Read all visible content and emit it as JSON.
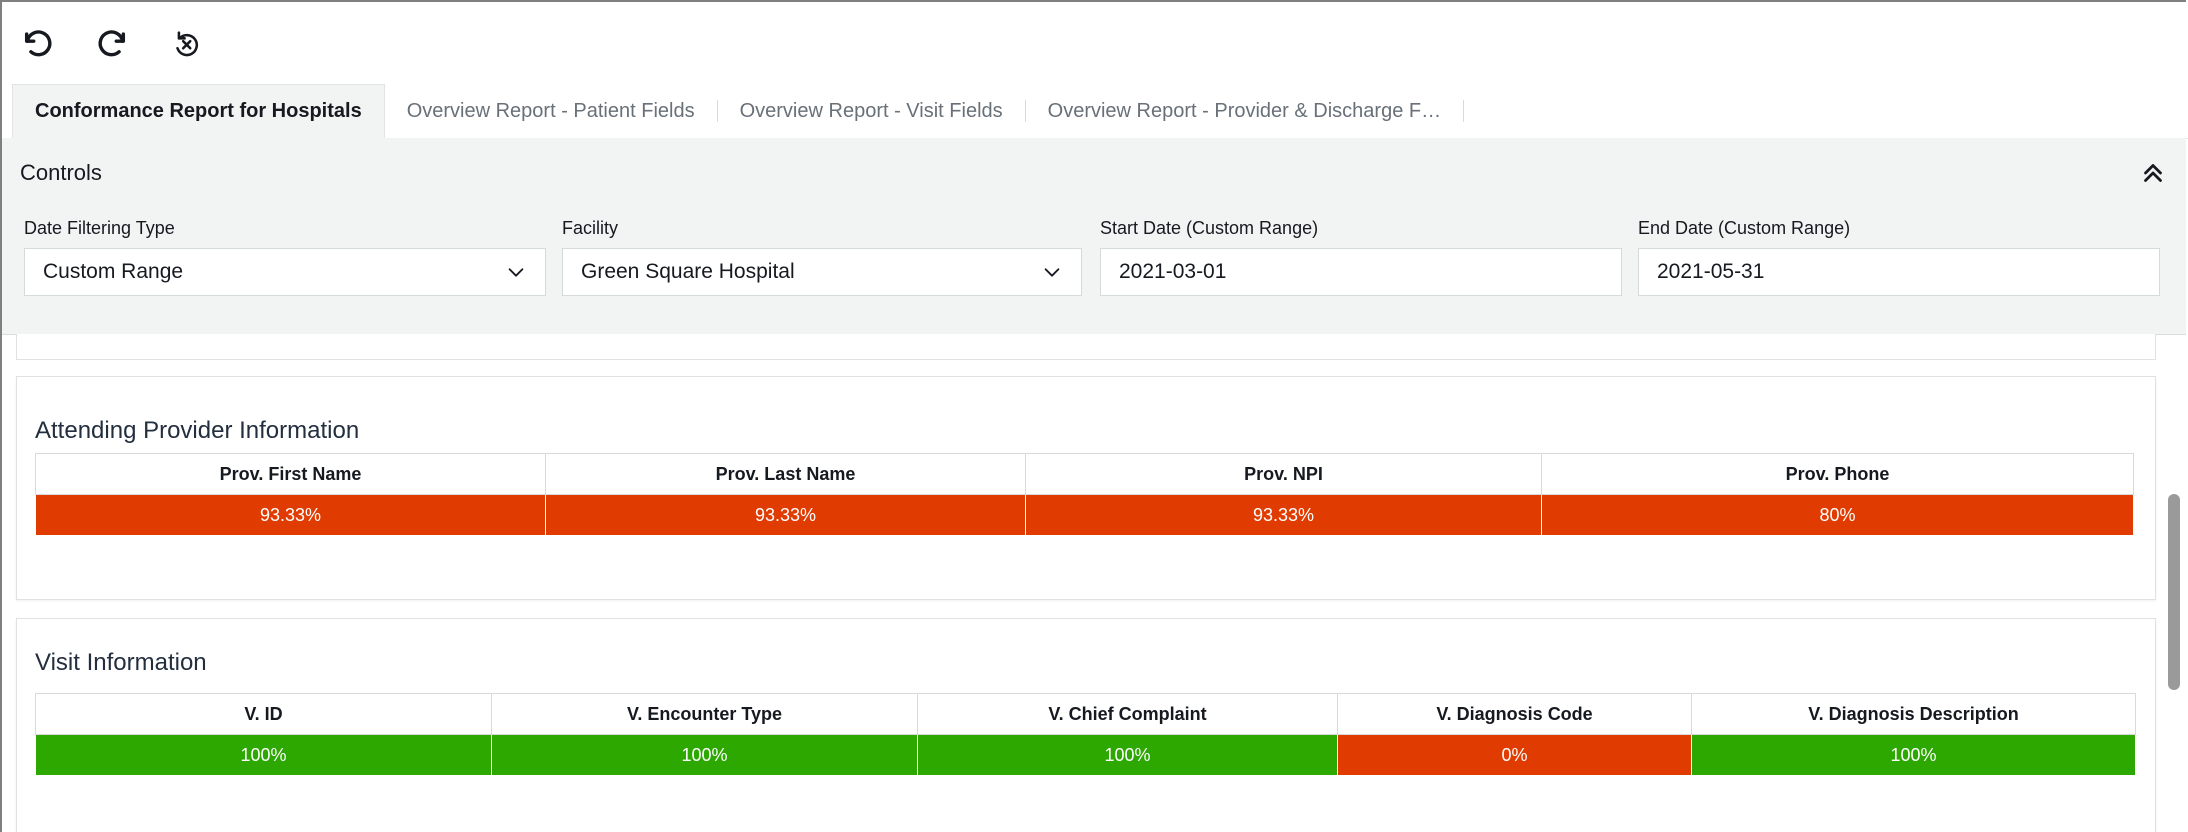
{
  "toolbar": {
    "undo_icon": "undo-icon",
    "redo_icon": "redo-icon",
    "reset_icon": "reset-icon"
  },
  "tabs": [
    {
      "label": "Conformance Report for Hospitals",
      "active": true
    },
    {
      "label": "Overview Report - Patient Fields",
      "active": false
    },
    {
      "label": "Overview Report - Visit Fields",
      "active": false
    },
    {
      "label": "Overview Report - Provider & Discharge F…",
      "active": false
    }
  ],
  "controls": {
    "title": "Controls",
    "date_filtering_type": {
      "label": "Date Filtering Type",
      "value": "Custom Range"
    },
    "facility": {
      "label": "Facility",
      "value": "Green Square Hospital"
    },
    "start_date": {
      "label": "Start Date (Custom Range)",
      "value": "2021-03-01"
    },
    "end_date": {
      "label": "End Date (Custom Range)",
      "value": "2021-05-31"
    }
  },
  "colors": {
    "fail": "#e03b00",
    "pass": "#2ca800"
  },
  "attending_provider": {
    "title": "Attending Provider Information",
    "headers": [
      "Prov. First Name",
      "Prov. Last Name",
      "Prov. NPI",
      "Prov. Phone"
    ],
    "values": [
      "93.33%",
      "93.33%",
      "93.33%",
      "80%"
    ],
    "status": [
      "fail",
      "fail",
      "fail",
      "fail"
    ]
  },
  "visit_information": {
    "title": "Visit Information",
    "headers": [
      "V. ID",
      "V. Encounter Type",
      "V. Chief Complaint",
      "V. Diagnosis Code",
      "V. Diagnosis Description"
    ],
    "values": [
      "100%",
      "100%",
      "100%",
      "0%",
      "100%"
    ],
    "status": [
      "pass",
      "pass",
      "pass",
      "fail",
      "pass"
    ]
  }
}
